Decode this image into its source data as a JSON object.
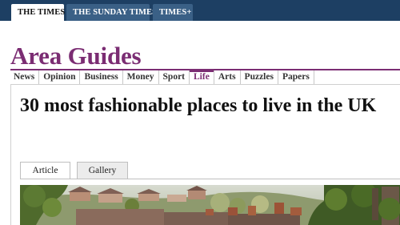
{
  "top_tabs": [
    {
      "label": "THE TIMES"
    },
    {
      "label": "THE SUNDAY TIMES"
    },
    {
      "label": "TIMES+"
    }
  ],
  "masthead": {
    "title": "Area Guides"
  },
  "nav": {
    "items": [
      {
        "label": "News"
      },
      {
        "label": "Opinion"
      },
      {
        "label": "Business"
      },
      {
        "label": "Money"
      },
      {
        "label": "Sport"
      },
      {
        "label": "Life"
      },
      {
        "label": "Arts"
      },
      {
        "label": "Puzzles"
      },
      {
        "label": "Papers"
      }
    ],
    "active": "Life"
  },
  "article": {
    "headline": "30 most fashionable places to live in the UK",
    "tabs": [
      {
        "label": "Article"
      },
      {
        "label": "Gallery"
      }
    ],
    "active_tab": "Article"
  },
  "colors": {
    "topbar": "#1d3f63",
    "brand": "#7b2d73"
  }
}
